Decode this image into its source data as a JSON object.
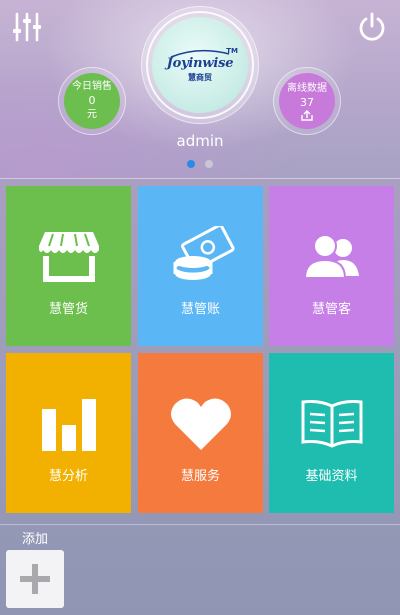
{
  "header": {
    "settings_icon": "sliders-icon",
    "power_icon": "power-icon",
    "brand": {
      "name": "Joyinwise",
      "tm": "TM",
      "cn": "慧商贸"
    },
    "sales": {
      "label": "今日销售",
      "value": "0",
      "unit": "元"
    },
    "offline": {
      "label": "离线数据",
      "value": "37",
      "icon": "upload-icon"
    },
    "username": "admin",
    "pager": {
      "total": 2,
      "active": 0
    }
  },
  "tiles": [
    {
      "label": "慧管货",
      "icon": "shop-icon",
      "color": "#6cbf4c"
    },
    {
      "label": "慧管账",
      "icon": "money-coins-icon",
      "color": "#5ab6f5"
    },
    {
      "label": "慧管客",
      "icon": "customers-icon",
      "color": "#c57fe6"
    },
    {
      "label": "慧分析",
      "icon": "bar-chart-icon",
      "color": "#f2b001"
    },
    {
      "label": "慧服务",
      "icon": "heart-icon",
      "color": "#f47a3e"
    },
    {
      "label": "基础资料",
      "icon": "book-icon",
      "color": "#1ebdb0"
    }
  ],
  "add": {
    "label": "添加",
    "icon": "plus-icon"
  }
}
